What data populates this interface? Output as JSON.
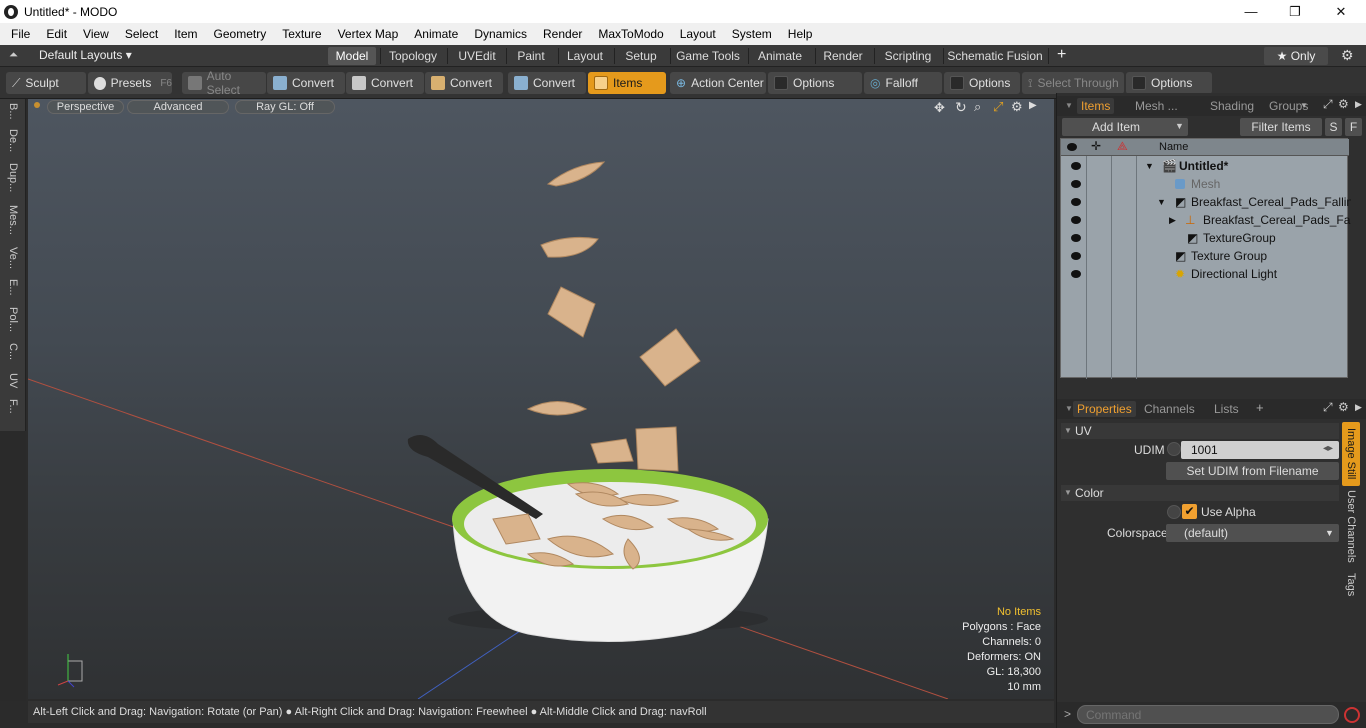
{
  "window": {
    "title": "Untitled* - MODO",
    "min": "—",
    "max": "❐",
    "close": "✕"
  },
  "menu": [
    "File",
    "Edit",
    "View",
    "Select",
    "Item",
    "Geometry",
    "Texture",
    "Vertex Map",
    "Animate",
    "Dynamics",
    "Render",
    "MaxToModo",
    "Layout",
    "System",
    "Help"
  ],
  "layouts": {
    "selector": "Default Layouts ▾",
    "tabs": [
      "Model",
      "Topology",
      "UVEdit",
      "Paint",
      "Layout",
      "Setup",
      "Game Tools",
      "Animate",
      "Render",
      "Scripting",
      "Schematic Fusion"
    ],
    "active": "Model",
    "add": "+",
    "only": "★ Only"
  },
  "toolbar": {
    "sculpt": "Sculpt",
    "presets": "Presets",
    "presets_key": "F6",
    "auto_select": "Auto Select",
    "convert1": "Convert",
    "convert2": "Convert",
    "convert3": "Convert",
    "convert4": "Convert",
    "items": "Items",
    "action_center": "Action Center",
    "options1": "Options",
    "falloff": "Falloff",
    "options2": "Options",
    "select_through": "Select Through",
    "options3": "Options"
  },
  "leftstrip": [
    "B...",
    "De...",
    "Dup...",
    "Mes...",
    "Ve...",
    "E...",
    "Pol...",
    "C...",
    "UV",
    "F..."
  ],
  "viewport": {
    "perspective": "Perspective",
    "advanced": "Advanced",
    "raygl": "Ray GL: Off",
    "info": {
      "no_items": "No Items",
      "polygons": "Polygons : Face",
      "channels": "Channels: 0",
      "deformers": "Deformers: ON",
      "gl": "GL: 18,300",
      "mm": "10 mm"
    }
  },
  "status": "Alt-Left Click and Drag: Navigation: Rotate (or Pan) ● Alt-Right Click and Drag: Navigation: Freewheel ● Alt-Middle Click and Drag: navRoll",
  "items_panel": {
    "tabs": [
      "Items",
      "Mesh ...",
      "Shading",
      "Groups"
    ],
    "active_tab": "Items",
    "add_item": "Add Item",
    "filter_items": "Filter Items",
    "s": "S",
    "f": "F",
    "name_header": "Name",
    "tree": [
      {
        "label": "Untitled*",
        "bold": true,
        "dim": false
      },
      {
        "label": "Mesh",
        "bold": false,
        "dim": true
      },
      {
        "label": "Breakfast_Cereal_Pads_Falling...",
        "bold": false,
        "dim": false
      },
      {
        "label": "Breakfast_Cereal_Pads_Falli...",
        "bold": false,
        "dim": false
      },
      {
        "label": "TextureGroup",
        "bold": false,
        "dim": false
      },
      {
        "label": "Texture Group",
        "bold": false,
        "dim": false
      },
      {
        "label": "Directional Light",
        "bold": false,
        "dim": false
      }
    ]
  },
  "properties_panel": {
    "tabs": [
      "Properties",
      "Channels",
      "Lists"
    ],
    "active_tab": "Properties",
    "add": "+",
    "uv_section": "UV",
    "udim_label": "UDIM",
    "udim_value": "1001",
    "set_udim": "Set UDIM from Filename",
    "color_section": "Color",
    "use_alpha": "Use Alpha",
    "colorspace_label": "Colorspace",
    "colorspace_value": "(default)",
    "side_tabs": [
      "Image Still",
      "User Channels",
      "Tags"
    ]
  },
  "command": {
    "prompt": ">",
    "placeholder": "Command"
  },
  "colors": {
    "accent": "#f0a030",
    "bowl_rim": "#8dc63f",
    "cereal": "#d9b38c"
  }
}
